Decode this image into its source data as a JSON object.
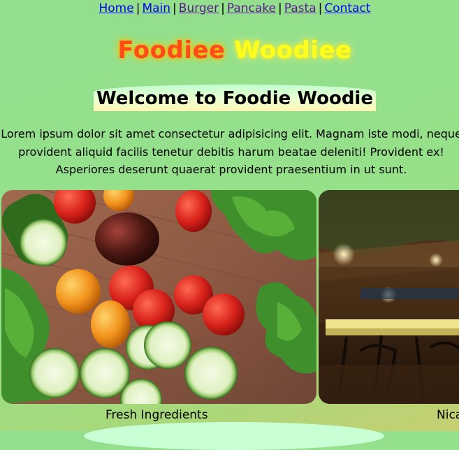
{
  "nav": {
    "items": [
      "Home",
      "Main",
      "Burger",
      "Pancake",
      "Pasta",
      "Contact"
    ],
    "separator": "|"
  },
  "brand": {
    "word1": "Foodiee",
    "word2": "Woodiee",
    "colors": [
      "#ff4d1a",
      "#ffff1f"
    ]
  },
  "welcome": {
    "title": "Welcome to Foodie Woodie"
  },
  "intro": {
    "text": "Lorem ipsum dolor sit amet consectetur adipisicing elit. Magnam iste modi, neque provident aliquid facilis tenetur debitis harum beatae deleniti! Provident ex! Asperiores deserunt quaerat provident praesentium in ut sunt."
  },
  "cards": [
    {
      "caption": "Fresh Ingredients",
      "image": "vegetables-photo"
    },
    {
      "caption": "Nica",
      "image": "restaurant-photo"
    }
  ]
}
